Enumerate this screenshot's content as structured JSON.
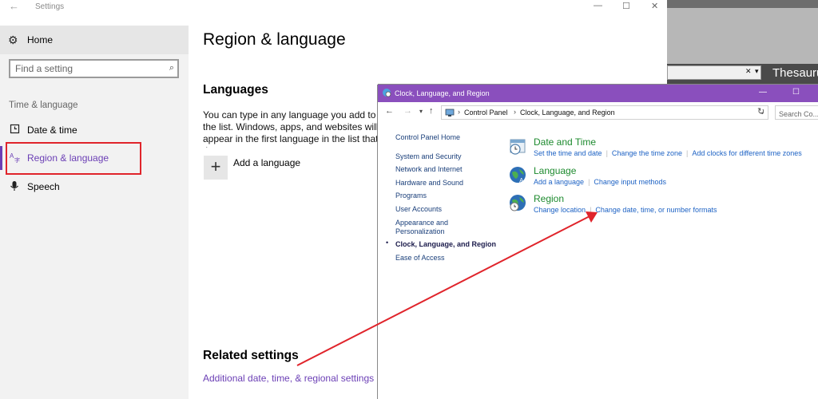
{
  "background_app": {
    "search_title": "Thesaurus"
  },
  "settings": {
    "window_title": "Settings",
    "home_label": "Home",
    "search_placeholder": "Find a setting",
    "section_heading": "Time & language",
    "nav_items": [
      {
        "label": "Date & time",
        "icon": "clock-icon"
      },
      {
        "label": "Region & language",
        "icon": "region-language-icon",
        "active": true
      },
      {
        "label": "Speech",
        "icon": "microphone-icon"
      }
    ],
    "page_title": "Region & language",
    "languages_heading": "Languages",
    "languages_description": "You can type in any language you add to the list. Windows, apps, and websites will appear in the first language in the list that they support",
    "add_language_label": "Add a language",
    "related_heading": "Related settings",
    "related_link": "Additional date, time, & regional settings",
    "accent_color": "#6b3fb5"
  },
  "control_panel": {
    "window_title": "Clock, Language, and Region",
    "title_color": "#8a4fbd",
    "breadcrumb": [
      "Control Panel",
      "Clock, Language, and Region"
    ],
    "search_placeholder": "Search Co...",
    "home_link": "Control Panel Home",
    "left_links": [
      "System and Security",
      "Network and Internet",
      "Hardware and Sound",
      "Programs",
      "User Accounts",
      "Appearance and",
      "Personalization"
    ],
    "current_item": "Clock, Language, and Region",
    "ease_link": "Ease of Access",
    "categories": [
      {
        "title": "Date and Time",
        "icon": "date-time-icon",
        "links": [
          "Set the time and date",
          "Change the time zone",
          "Add clocks for different time zones"
        ]
      },
      {
        "title": "Language",
        "icon": "language-globe-icon",
        "links": [
          "Add a language",
          "Change input methods"
        ]
      },
      {
        "title": "Region",
        "icon": "region-globe-icon",
        "links": [
          "Change location",
          "Change date, time, or number formats"
        ]
      }
    ],
    "title_green": "#1d8a2e",
    "link_blue": "#1d62c4"
  },
  "annotation_color": "#e0242b"
}
